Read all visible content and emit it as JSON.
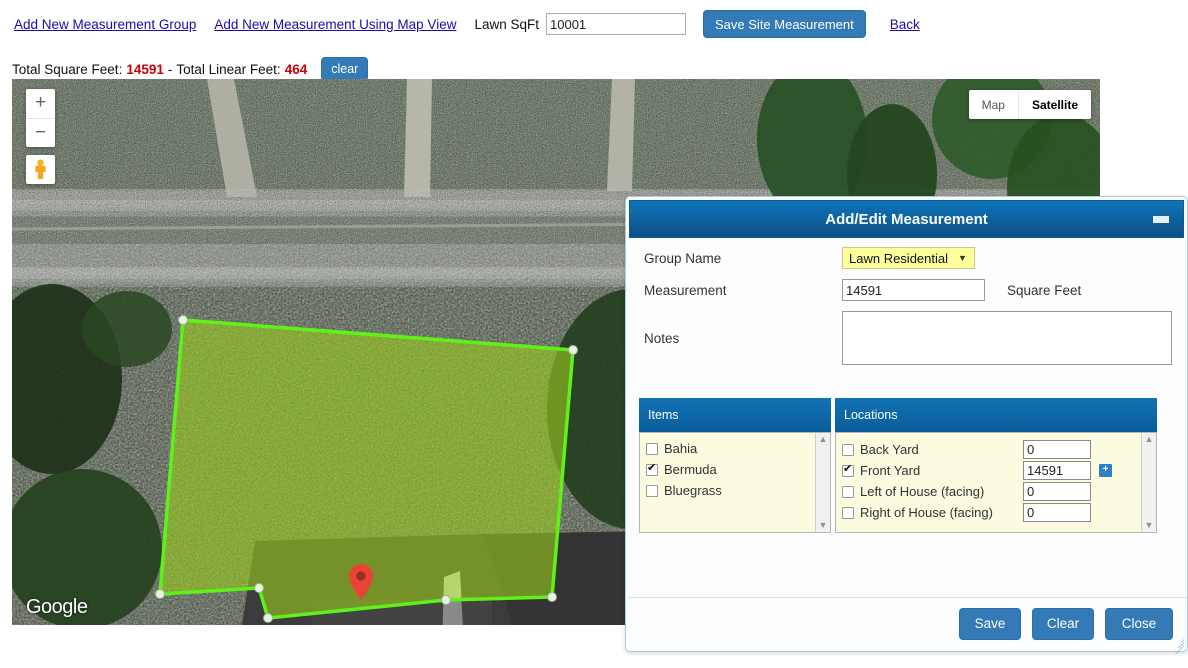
{
  "toolbar": {
    "add_group_link": "Add New Measurement Group",
    "add_mapview_link": "Add New Measurement Using Map View",
    "lawn_sqft_label": "Lawn SqFt",
    "lawn_sqft_value": "10001",
    "save_site_button": "Save Site Measurement",
    "back_link": "Back"
  },
  "totals": {
    "sqft_label": "Total Square Feet:",
    "sqft_value": "14591",
    "separator": "-",
    "linear_label": "Total Linear Feet:",
    "linear_value": "464",
    "clear_button": "clear"
  },
  "map": {
    "zoom_in": "+",
    "zoom_out": "−",
    "pegman": "street-view-pegman",
    "type_map": "Map",
    "type_satellite": "Satellite",
    "active_type": "Satellite",
    "attribution": "Google",
    "polygon_color": "#6ddb1f",
    "polygon_fill": "#8fc020",
    "marker_color": "#ea4335"
  },
  "dialog": {
    "title": "Add/Edit Measurement",
    "minimize": "minimize",
    "group_name_label": "Group Name",
    "group_name_value": "Lawn Residential",
    "measurement_label": "Measurement",
    "measurement_value": "14591",
    "measurement_unit": "Square Feet",
    "notes_label": "Notes",
    "notes_value": "",
    "items_header": "Items",
    "locations_header": "Locations",
    "items": [
      {
        "label": "Bahia",
        "checked": false
      },
      {
        "label": "Bermuda",
        "checked": true
      },
      {
        "label": "Bluegrass",
        "checked": false
      }
    ],
    "locations": [
      {
        "label": "Back Yard",
        "checked": false,
        "value": "0",
        "has_plus": false
      },
      {
        "label": "Front Yard",
        "checked": true,
        "value": "14591",
        "has_plus": true
      },
      {
        "label": "Left of House (facing)",
        "checked": false,
        "value": "0",
        "has_plus": false
      },
      {
        "label": "Right of House (facing)",
        "checked": false,
        "value": "0",
        "has_plus": false
      }
    ],
    "save_button": "Save",
    "clear_button": "Clear",
    "close_button": "Close"
  }
}
